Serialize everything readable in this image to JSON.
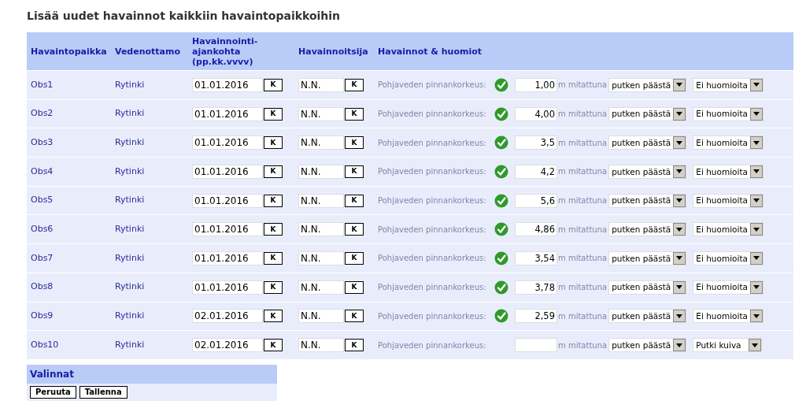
{
  "title": "Lisää uudet havainnot kaikkiin havaintopaikkoihin",
  "table": {
    "columns": [
      "Havaintopaikka",
      "Vedenottamo",
      "Havainnointi-ajankohta (pp.kk.vvvv)",
      "Havainnoitsija",
      "Havainnot & huomiot"
    ],
    "rows": [
      {
        "place": "Obs1",
        "intake": "Rytinki",
        "date": "01.01.2016",
        "date_button": "K",
        "observer": "N.N.",
        "observer_button": "K",
        "label": "Pohjaveden pinnankorkeus:",
        "valid": true,
        "value": "1,00",
        "unit": "m mitattuna",
        "method": "putken päästä",
        "note": "Ei huomioita"
      },
      {
        "place": "Obs2",
        "intake": "Rytinki",
        "date": "01.01.2016",
        "date_button": "K",
        "observer": "N.N.",
        "observer_button": "K",
        "label": "Pohjaveden pinnankorkeus:",
        "valid": true,
        "value": "4,00",
        "unit": "m mitattuna",
        "method": "putken päästä",
        "note": "Ei huomioita"
      },
      {
        "place": "Obs3",
        "intake": "Rytinki",
        "date": "01.01.2016",
        "date_button": "K",
        "observer": "N.N.",
        "observer_button": "K",
        "label": "Pohjaveden pinnankorkeus:",
        "valid": true,
        "value": "3,5",
        "unit": "m mitattuna",
        "method": "putken päästä",
        "note": "Ei huomioita"
      },
      {
        "place": "Obs4",
        "intake": "Rytinki",
        "date": "01.01.2016",
        "date_button": "K",
        "observer": "N.N.",
        "observer_button": "K",
        "label": "Pohjaveden pinnankorkeus:",
        "valid": true,
        "value": "4,2",
        "unit": "m mitattuna",
        "method": "putken päästä",
        "note": "Ei huomioita"
      },
      {
        "place": "Obs5",
        "intake": "Rytinki",
        "date": "01.01.2016",
        "date_button": "K",
        "observer": "N.N.",
        "observer_button": "K",
        "label": "Pohjaveden pinnankorkeus:",
        "valid": true,
        "value": "5,6",
        "unit": "m mitattuna",
        "method": "putken päästä",
        "note": "Ei huomioita"
      },
      {
        "place": "Obs6",
        "intake": "Rytinki",
        "date": "01.01.2016",
        "date_button": "K",
        "observer": "N.N.",
        "observer_button": "K",
        "label": "Pohjaveden pinnankorkeus:",
        "valid": true,
        "value": "4,86",
        "unit": "m mitattuna",
        "method": "putken päästä",
        "note": "Ei huomioita"
      },
      {
        "place": "Obs7",
        "intake": "Rytinki",
        "date": "01.01.2016",
        "date_button": "K",
        "observer": "N.N.",
        "observer_button": "K",
        "label": "Pohjaveden pinnankorkeus:",
        "valid": true,
        "value": "3,54",
        "unit": "m mitattuna",
        "method": "putken päästä",
        "note": "Ei huomioita"
      },
      {
        "place": "Obs8",
        "intake": "Rytinki",
        "date": "01.01.2016",
        "date_button": "K",
        "observer": "N.N.",
        "observer_button": "K",
        "label": "Pohjaveden pinnankorkeus:",
        "valid": true,
        "value": "3,78",
        "unit": "m mitattuna",
        "method": "putken päästä",
        "note": "Ei huomioita"
      },
      {
        "place": "Obs9",
        "intake": "Rytinki",
        "date": "02.01.2016",
        "date_button": "K",
        "observer": "N.N.",
        "observer_button": "K",
        "label": "Pohjaveden pinnankorkeus:",
        "valid": true,
        "value": "2,59",
        "unit": "m mitattuna",
        "method": "putken päästä",
        "note": "Ei huomioita"
      },
      {
        "place": "Obs10",
        "intake": "Rytinki",
        "date": "02.01.2016",
        "date_button": "K",
        "observer": "N.N.",
        "observer_button": "K",
        "label": "Pohjaveden pinnankorkeus:",
        "valid": false,
        "unit": "m mitattuna",
        "method": "putken päästä",
        "note": "Putki kuiva"
      }
    ]
  },
  "options": {
    "title": "Valinnat",
    "buttons": [
      "Peruuta",
      "Tallenna"
    ]
  }
}
